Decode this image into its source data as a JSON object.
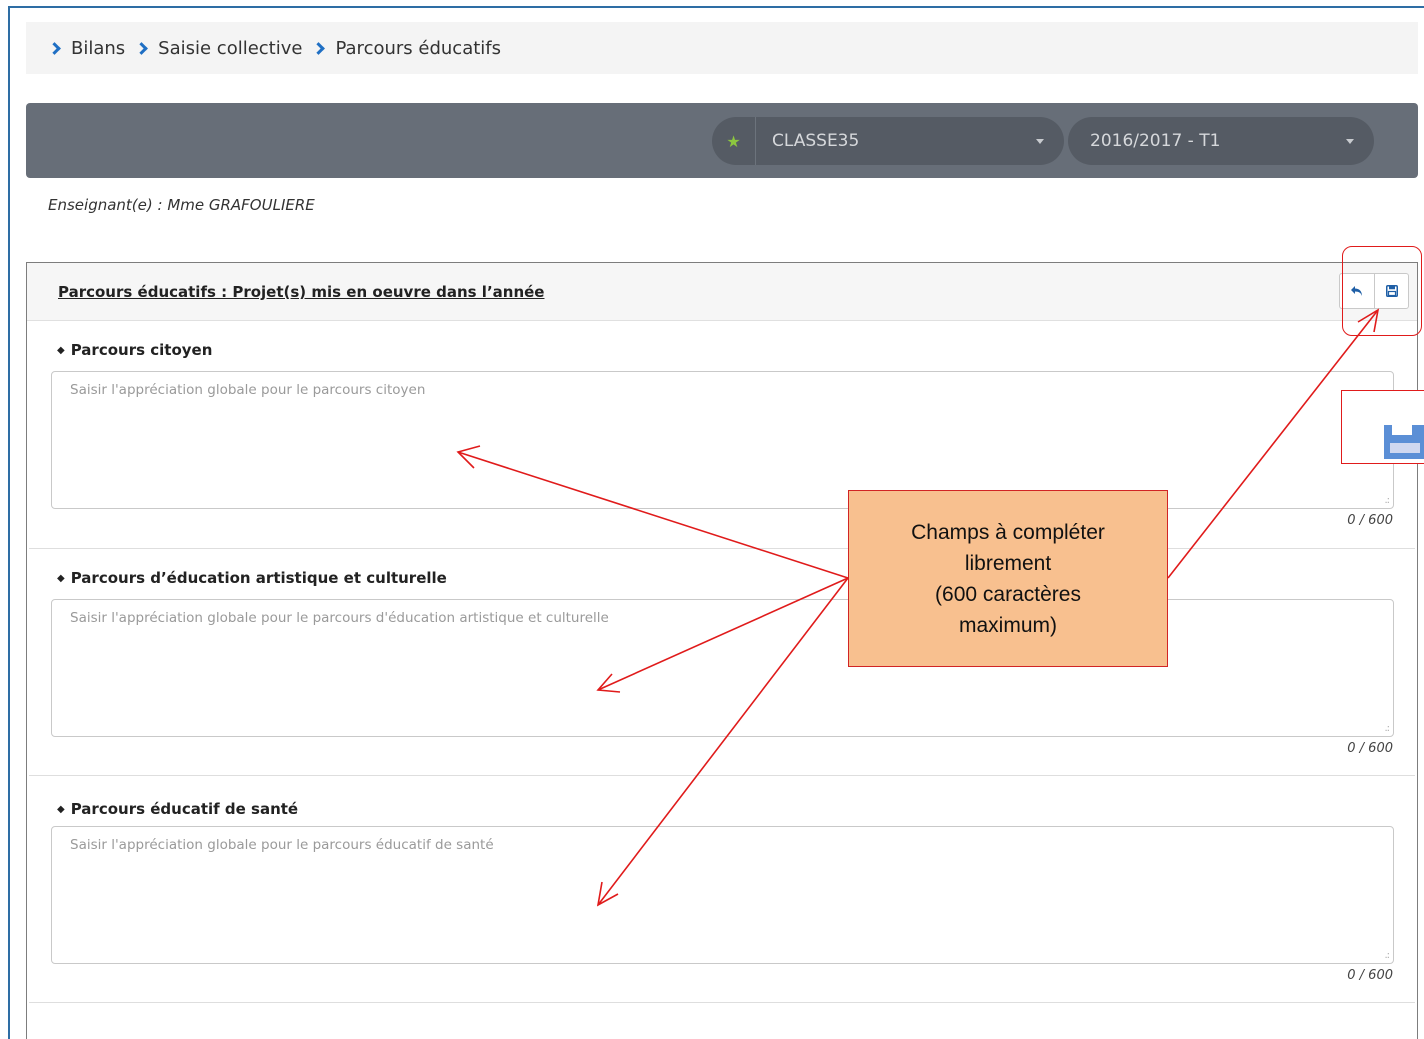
{
  "breadcrumb": {
    "items": [
      "Bilans",
      "Saisie collective",
      "Parcours éducatifs"
    ]
  },
  "filters": {
    "classe": "CLASSE35",
    "periode": "2016/2017 - T1"
  },
  "teacher_label": "Enseignant(e) : Mme GRAFOULIERE",
  "panel": {
    "title": "Parcours éducatifs : Projet(s) mis en oeuvre dans l’année",
    "sections": [
      {
        "label": "Parcours citoyen",
        "placeholder": "Saisir l'appréciation globale pour le parcours citoyen",
        "counter": "0 / 600"
      },
      {
        "label": "Parcours d’éducation artistique et culturelle",
        "placeholder": "Saisir l'appréciation globale pour le parcours d'éducation artistique et culturelle",
        "counter": "0 / 600"
      },
      {
        "label": "Parcours éducatif de santé",
        "placeholder": "Saisir l'appréciation globale pour le parcours éducatif de santé",
        "counter": "0 / 600"
      }
    ]
  },
  "annotation": {
    "callout_text": "Champs à compléter\nlibrement\n(600 caractères\nmaximum)"
  },
  "colors": {
    "accent": "#1f6fc4",
    "topbar": "#676e78",
    "annotation_red": "#e01b1b",
    "callout_fill": "#f8c08f"
  }
}
